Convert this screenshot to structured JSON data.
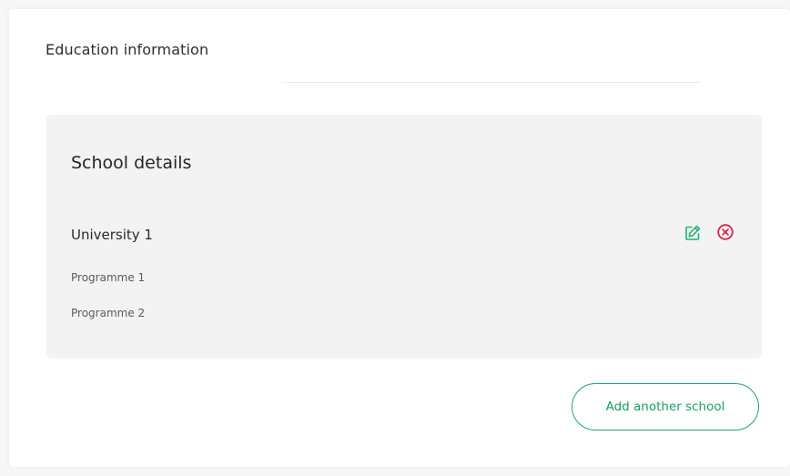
{
  "section": {
    "title": "Education information"
  },
  "school_details": {
    "heading": "School details",
    "university": "University 1",
    "programmes": [
      "Programme 1",
      "Programme 2"
    ],
    "actions": {
      "edit_icon": "edit-icon",
      "remove_icon": "remove-circle-x-icon"
    }
  },
  "footer": {
    "add_school_label": "Add another school"
  },
  "colors": {
    "accent_green": "#1a9e63",
    "danger_red": "#d9254a",
    "panel_bg": "#f3f3f4"
  }
}
